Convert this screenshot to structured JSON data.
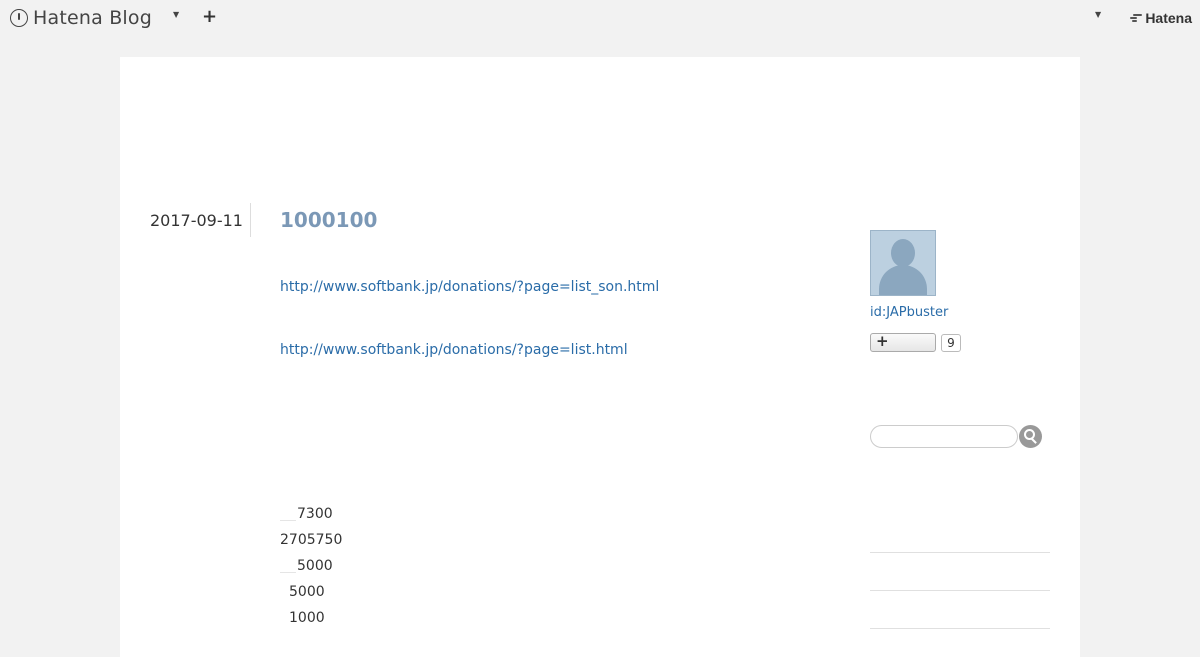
{
  "topbar": {
    "brand": "Hatena Blog",
    "add_label": "+",
    "hatena_label": "Hatena"
  },
  "entry": {
    "date": "2017-09-11",
    "title": "1000100",
    "links": [
      "http://www.softbank.jp/donations/?page=list_son.html",
      "http://www.softbank.jp/donations/?page=list.html"
    ],
    "numbers": [
      "7300",
      "2705750",
      "5000",
      "5000",
      "1000"
    ]
  },
  "sidebar": {
    "user_id": "id:JAPbuster",
    "follow_label": "+",
    "follow_count": "9",
    "search_placeholder": ""
  }
}
